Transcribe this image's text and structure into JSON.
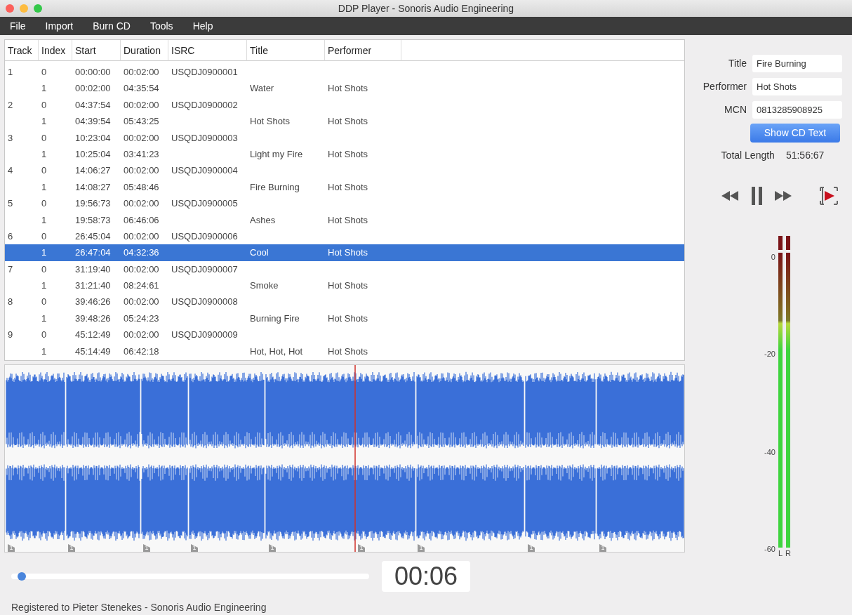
{
  "window": {
    "title": "DDP Player - Sonoris Audio Engineering"
  },
  "menu": [
    "File",
    "Import",
    "Burn CD",
    "Tools",
    "Help"
  ],
  "table": {
    "columns": [
      "Track",
      "Index",
      "Start",
      "Duration",
      "ISRC",
      "Title",
      "Performer"
    ],
    "rows": [
      {
        "cells": [
          "1",
          "0",
          "00:00:00",
          "00:02:00",
          "USQDJ0900001",
          "",
          ""
        ],
        "selected": false
      },
      {
        "cells": [
          "",
          "1",
          "00:02:00",
          "04:35:54",
          "",
          "Water",
          "Hot Shots"
        ],
        "selected": false
      },
      {
        "cells": [
          "2",
          "0",
          "04:37:54",
          "00:02:00",
          "USQDJ0900002",
          "",
          ""
        ],
        "selected": false
      },
      {
        "cells": [
          "",
          "1",
          "04:39:54",
          "05:43:25",
          "",
          "Hot Shots",
          "Hot Shots"
        ],
        "selected": false
      },
      {
        "cells": [
          "3",
          "0",
          "10:23:04",
          "00:02:00",
          "USQDJ0900003",
          "",
          ""
        ],
        "selected": false
      },
      {
        "cells": [
          "",
          "1",
          "10:25:04",
          "03:41:23",
          "",
          "Light my Fire",
          "Hot Shots"
        ],
        "selected": false
      },
      {
        "cells": [
          "4",
          "0",
          "14:06:27",
          "00:02:00",
          "USQDJ0900004",
          "",
          ""
        ],
        "selected": false
      },
      {
        "cells": [
          "",
          "1",
          "14:08:27",
          "05:48:46",
          "",
          "Fire Burning",
          "Hot Shots"
        ],
        "selected": false
      },
      {
        "cells": [
          "5",
          "0",
          "19:56:73",
          "00:02:00",
          "USQDJ0900005",
          "",
          ""
        ],
        "selected": false
      },
      {
        "cells": [
          "",
          "1",
          "19:58:73",
          "06:46:06",
          "",
          "Ashes",
          "Hot Shots"
        ],
        "selected": false
      },
      {
        "cells": [
          "6",
          "0",
          "26:45:04",
          "00:02:00",
          "USQDJ0900006",
          "",
          ""
        ],
        "selected": false
      },
      {
        "cells": [
          "",
          "1",
          "26:47:04",
          "04:32:36",
          "",
          "Cool",
          "Hot Shots"
        ],
        "selected": true
      },
      {
        "cells": [
          "7",
          "0",
          "31:19:40",
          "00:02:00",
          "USQDJ0900007",
          "",
          ""
        ],
        "selected": false
      },
      {
        "cells": [
          "",
          "1",
          "31:21:40",
          "08:24:61",
          "",
          "Smoke",
          "Hot Shots"
        ],
        "selected": false
      },
      {
        "cells": [
          "8",
          "0",
          "39:46:26",
          "00:02:00",
          "USQDJ0900008",
          "",
          ""
        ],
        "selected": false
      },
      {
        "cells": [
          "",
          "1",
          "39:48:26",
          "05:24:23",
          "",
          "Burning Fire",
          "Hot Shots"
        ],
        "selected": false
      },
      {
        "cells": [
          "9",
          "0",
          "45:12:49",
          "00:02:00",
          "USQDJ0900009",
          "",
          ""
        ],
        "selected": false
      },
      {
        "cells": [
          "",
          "1",
          "45:14:49",
          "06:42:18",
          "",
          "Hot, Hot, Hot",
          "Hot Shots"
        ],
        "selected": false
      }
    ]
  },
  "waveform": {
    "markers": [
      "1",
      "1",
      "1",
      "1",
      "1",
      "1",
      "1",
      "1",
      "1"
    ]
  },
  "position": {
    "level": 0.03,
    "time": "00:06"
  },
  "info": {
    "fields": [
      {
        "label": "Title",
        "value": "Fire Burning"
      },
      {
        "label": "Performer",
        "value": "Hot Shots"
      },
      {
        "label": "MCN",
        "value": "0813285908925"
      }
    ],
    "button": "Show CD Text",
    "total_label": "Total Length",
    "total_value": "51:56:67"
  },
  "meter": {
    "scale": [
      "0",
      "-20",
      "-40",
      "-60"
    ],
    "channels": [
      {
        "name": "L",
        "level": 1.0
      },
      {
        "name": "R",
        "level": 1.0
      }
    ]
  },
  "status_bar": "Registered to Pieter Stenekes - Sonoris Audio Engineering"
}
